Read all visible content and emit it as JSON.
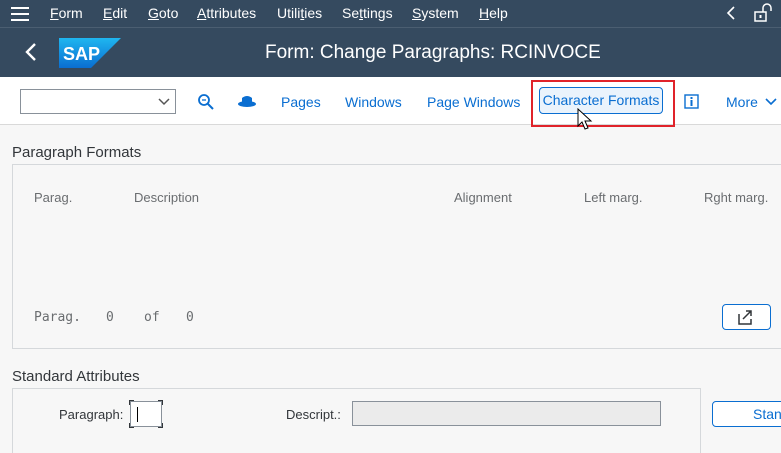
{
  "menubar": {
    "items": [
      {
        "pre": "",
        "ul": "F",
        "post": "orm"
      },
      {
        "pre": "",
        "ul": "E",
        "post": "dit"
      },
      {
        "pre": "",
        "ul": "G",
        "post": "oto"
      },
      {
        "pre": "",
        "ul": "A",
        "post": "ttributes"
      },
      {
        "pre": "Utili",
        "ul": "t",
        "post": "ies"
      },
      {
        "pre": "Se",
        "ul": "t",
        "post": "tings"
      },
      {
        "pre": "",
        "ul": "S",
        "post": "ystem"
      },
      {
        "pre": "",
        "ul": "H",
        "post": "elp"
      }
    ]
  },
  "titlebar": {
    "title": "Form: Change Paragraphs: RCINVOCE",
    "logo_text": "SAP"
  },
  "toolbar": {
    "dropdown_value": "",
    "pages": "Pages",
    "windows": "Windows",
    "page_windows": "Page Windows",
    "character_formats": "Character Formats",
    "more": "More"
  },
  "paragraph_formats": {
    "title": "Paragraph Formats",
    "columns": [
      "Parag.",
      "Description",
      "Alignment",
      "Left marg.",
      "Rght marg."
    ],
    "count_label": "Parag.",
    "count_value": "0",
    "of_label": "of",
    "total": "0"
  },
  "standard_attributes": {
    "title": "Standard Attributes",
    "paragraph_label": "Paragraph:",
    "paragraph_value": "",
    "description_label": "Descript.:",
    "description_value": "",
    "standard_button": "Stan"
  },
  "colors": {
    "shell": "#354a5f",
    "accent": "#0a6ed1",
    "highlight": "#e0232a"
  }
}
